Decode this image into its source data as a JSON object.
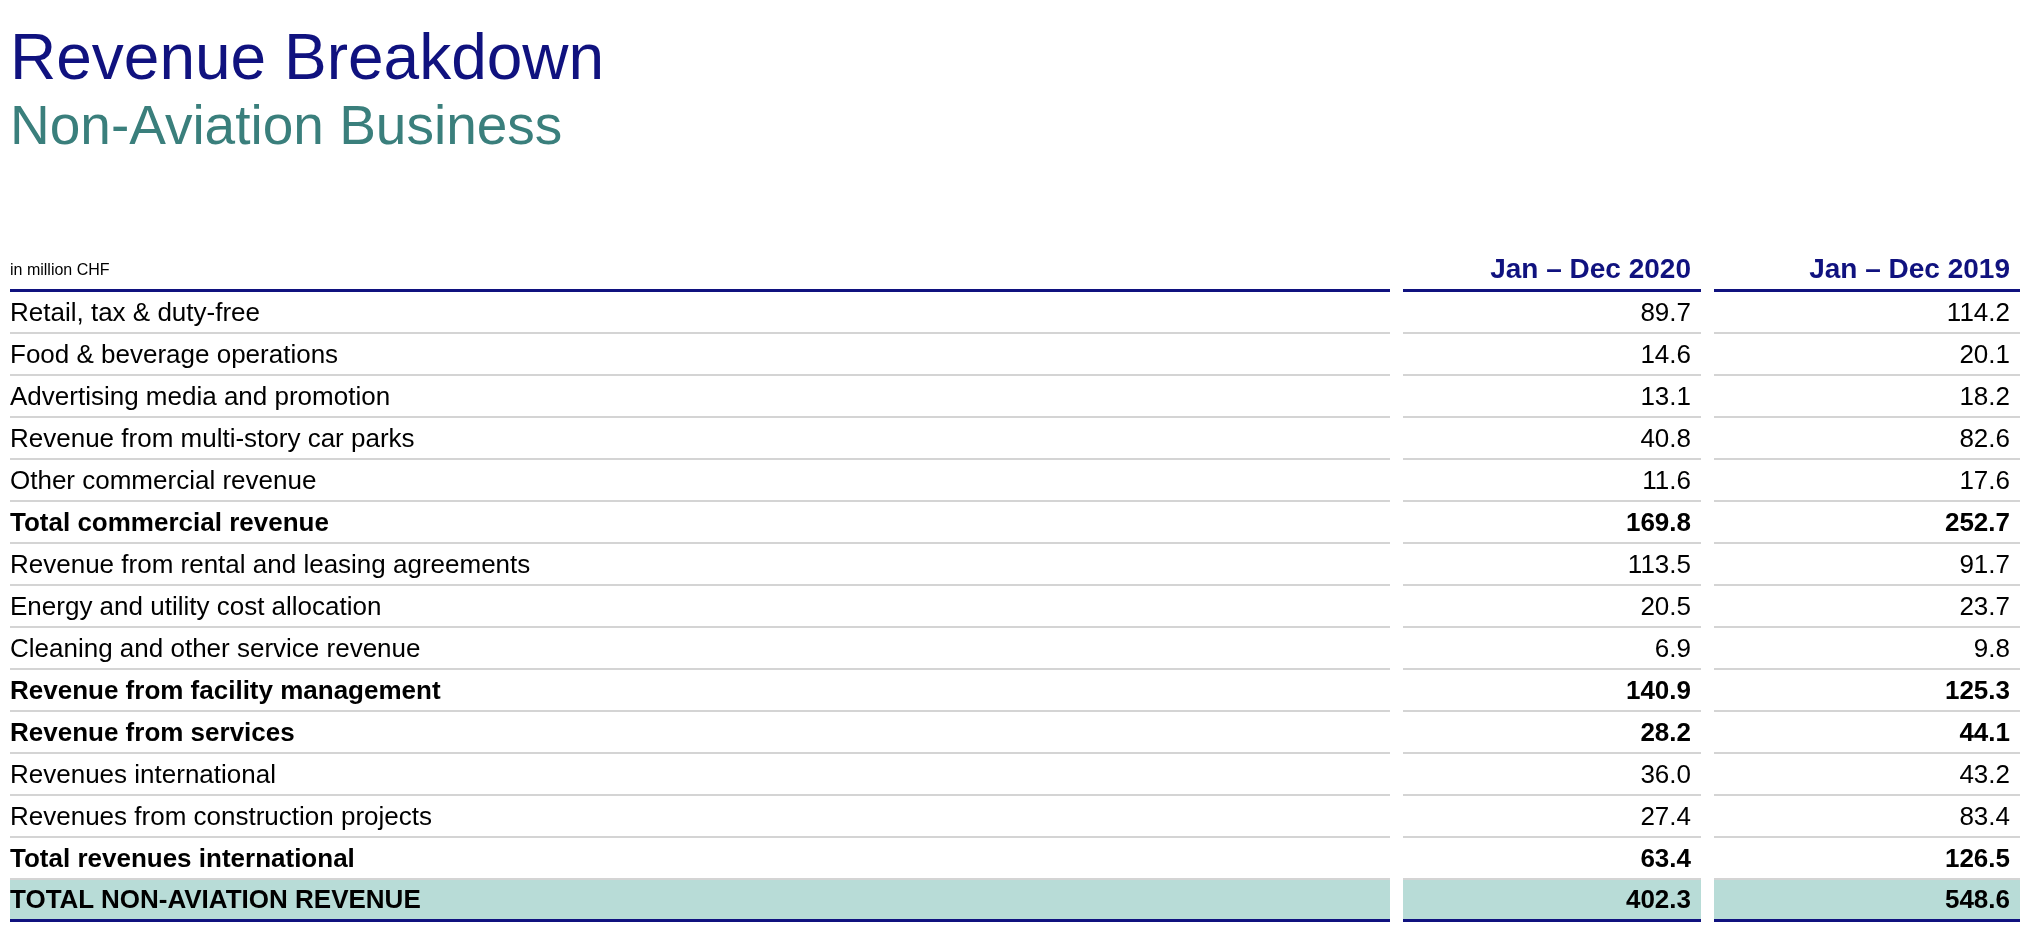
{
  "title": "Revenue Breakdown",
  "subtitle": "Non-Aviation Business",
  "table": {
    "unit_label": "in million CHF",
    "columns": [
      "Jan – Dec 2020",
      "Jan – Dec 2019"
    ],
    "rows": [
      {
        "label": "Retail, tax & duty-free",
        "values": [
          "89.7",
          "114.2"
        ],
        "kind": "item"
      },
      {
        "label": "Food & beverage operations",
        "values": [
          "14.6",
          "20.1"
        ],
        "kind": "item"
      },
      {
        "label": "Advertising media and promotion",
        "values": [
          "13.1",
          "18.2"
        ],
        "kind": "item"
      },
      {
        "label": "Revenue from multi-story car parks",
        "values": [
          "40.8",
          "82.6"
        ],
        "kind": "item"
      },
      {
        "label": "Other commercial revenue",
        "values": [
          "11.6",
          "17.6"
        ],
        "kind": "item"
      },
      {
        "label": "Total commercial revenue",
        "values": [
          "169.8",
          "252.7"
        ],
        "kind": "subtotal"
      },
      {
        "label": "Revenue from rental and leasing agreements",
        "values": [
          "113.5",
          "91.7"
        ],
        "kind": "item"
      },
      {
        "label": "Energy and utility cost allocation",
        "values": [
          "20.5",
          "23.7"
        ],
        "kind": "item"
      },
      {
        "label": "Cleaning and other service revenue",
        "values": [
          "6.9",
          "9.8"
        ],
        "kind": "item"
      },
      {
        "label": "Revenue from facility management",
        "values": [
          "140.9",
          "125.3"
        ],
        "kind": "subtotal"
      },
      {
        "label": "Revenue from services",
        "values": [
          "28.2",
          "44.1"
        ],
        "kind": "subtotal"
      },
      {
        "label": "Revenues international",
        "values": [
          "36.0",
          "43.2"
        ],
        "kind": "item"
      },
      {
        "label": "Revenues from construction projects",
        "values": [
          "27.4",
          "83.4"
        ],
        "kind": "item"
      },
      {
        "label": "Total revenues international",
        "values": [
          "63.4",
          "126.5"
        ],
        "kind": "subtotal"
      },
      {
        "label": "TOTAL NON-AVIATION REVENUE",
        "values": [
          "402.3",
          "548.6"
        ],
        "kind": "total"
      }
    ]
  }
}
